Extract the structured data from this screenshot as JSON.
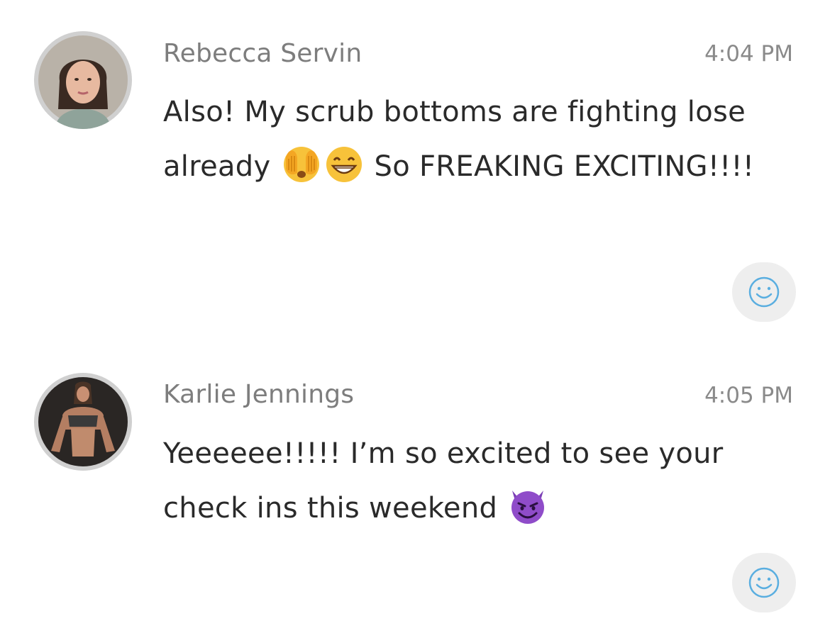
{
  "messages": [
    {
      "sender": "Rebecca Servin",
      "time": "4:04 PM",
      "text_part1": "Also! My scrub bottoms are fighting lose already ",
      "emojis_after_part1": [
        "face-with-hands-over-eyes-emoji",
        "grinning-face-emoji"
      ],
      "text_part2": " So FREAKING EXCITING!!!!",
      "avatar": "profile-photo-woman",
      "reaction_icon": "smiley-icon"
    },
    {
      "sender": "Karlie Jennings",
      "time": "4:05 PM",
      "text_part1": "Yeeeeee!!!!! I’m so excited to see your check ins this weekend ",
      "emojis_after_part1": [
        "smiling-devil-emoji"
      ],
      "reaction_icon": "smiley-icon"
    }
  ],
  "colors": {
    "sender": "#7d7d7d",
    "timestamp": "#8a8a8a",
    "body_text": "#2a2a2a",
    "reaction_bg": "#eeeeee",
    "reaction_icon": "#5aaee0",
    "avatar_ring": "#d5d5d5"
  }
}
